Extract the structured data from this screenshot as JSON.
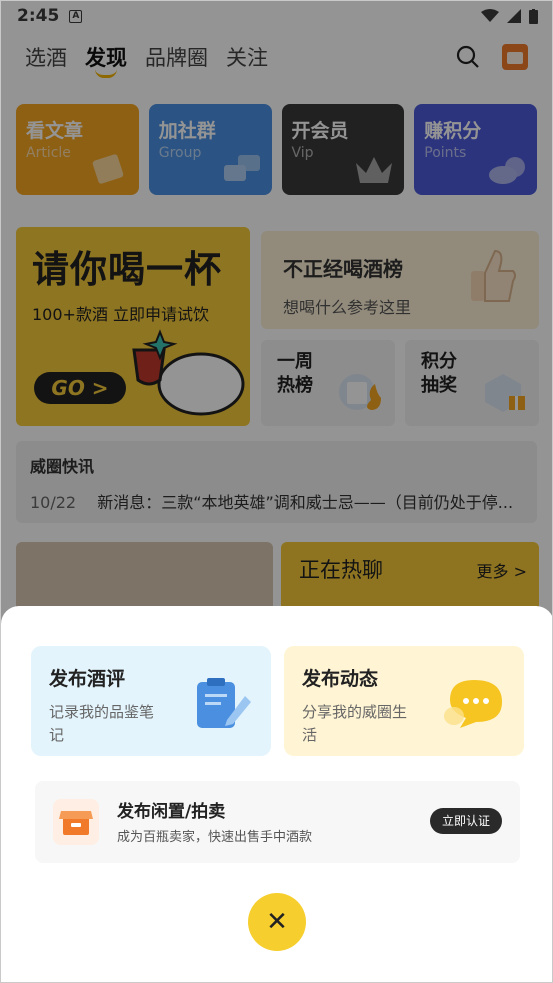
{
  "status": {
    "time": "2:45",
    "badge": "A"
  },
  "tabs": [
    "选酒",
    "发现",
    "品牌圈",
    "关注"
  ],
  "features": [
    {
      "title": "看文章",
      "subtitle": "Article",
      "color": "#f5a623"
    },
    {
      "title": "加社群",
      "subtitle": "Group",
      "color": "#4a90e2"
    },
    {
      "title": "开会员",
      "subtitle": "Vip",
      "color": "#3a3a3a"
    },
    {
      "title": "赚积分",
      "subtitle": "Points",
      "color": "#4d5bd8"
    }
  ],
  "promo": {
    "headline": "请你喝一杯",
    "subline": "100+款酒 立即申请试饮",
    "go": "GO >",
    "ranking_title": "不正经喝酒榜",
    "ranking_sub": "想喝什么参考这里",
    "weekly": [
      "一周",
      "热榜"
    ],
    "lottery": [
      "积分",
      "抽奖"
    ]
  },
  "news": {
    "title": "威圈快讯",
    "date": "10/22",
    "text": "新消息：三款“本地英雄”调和威士忌——（目前仍处于停..."
  },
  "trending": {
    "title": "正在热聊",
    "more": "更多 >"
  },
  "sheet": {
    "review": {
      "title": "发布酒评",
      "desc": "记录我的品鉴笔记"
    },
    "post": {
      "title": "发布动态",
      "desc": "分享我的威圈生活"
    },
    "sell": {
      "title": "发布闲置/拍卖",
      "desc": "成为百瓶卖家，快速出售手中酒款",
      "button": "立即认证"
    },
    "close": "✕"
  }
}
